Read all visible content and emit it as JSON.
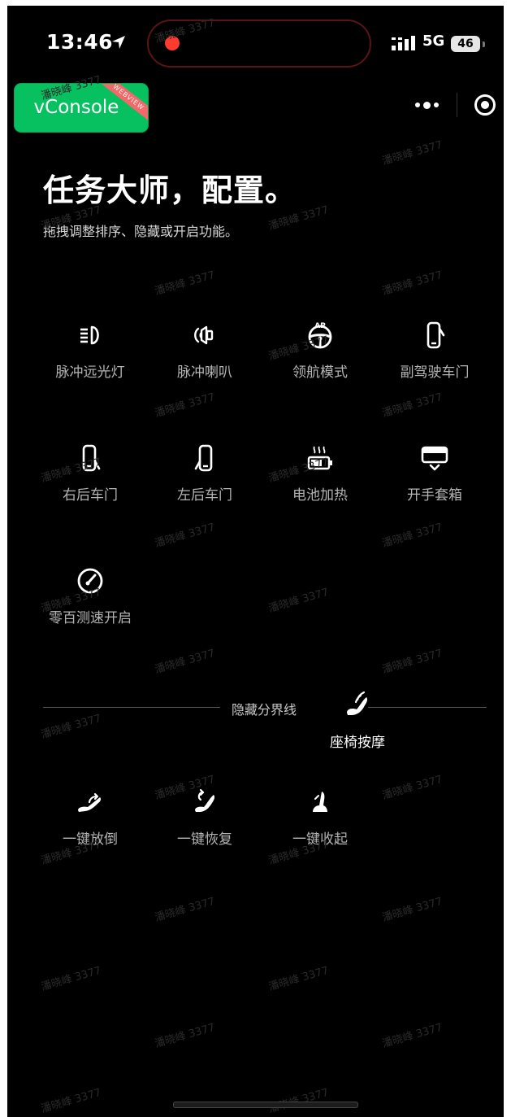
{
  "status_bar": {
    "time": "13:46",
    "network": "5G",
    "battery": "46",
    "recording_color": "#ff3b30"
  },
  "vconsole": {
    "label": "vConsole",
    "ribbon": "WEBVIEW",
    "color": "#07c160"
  },
  "capsule": {
    "more_icon": "more-dots-icon",
    "close_icon": "target-close-icon"
  },
  "header": {
    "title": "任务大师，配置。",
    "subtitle": "拖拽调整排序、隐藏或开启功能。"
  },
  "visible_items": [
    {
      "label": "脉冲远光灯",
      "icon": "high-beam-icon"
    },
    {
      "label": "脉冲喇叭",
      "icon": "horn-icon"
    },
    {
      "label": "领航模式",
      "icon": "autopilot-wheel-icon"
    },
    {
      "label": "副驾驶车门",
      "icon": "passenger-door-icon"
    },
    {
      "label": "右后车门",
      "icon": "rear-right-door-icon"
    },
    {
      "label": "左后车门",
      "icon": "rear-left-door-icon"
    },
    {
      "label": "电池加热",
      "icon": "battery-heat-icon"
    },
    {
      "label": "开手套箱",
      "icon": "glovebox-icon"
    },
    {
      "label": "零百测速开启",
      "icon": "speedometer-icon"
    }
  ],
  "divider": {
    "label": "隐藏分界线"
  },
  "dragging_item": {
    "label": "座椅按摩",
    "icon": "seat-massage-icon"
  },
  "hidden_items": [
    {
      "label": "一键放倒",
      "icon": "seat-recline-icon"
    },
    {
      "label": "一键恢复",
      "icon": "seat-restore-icon"
    },
    {
      "label": "一键收起",
      "icon": "seat-fold-icon"
    }
  ],
  "watermark": "潘晓峰 3377"
}
